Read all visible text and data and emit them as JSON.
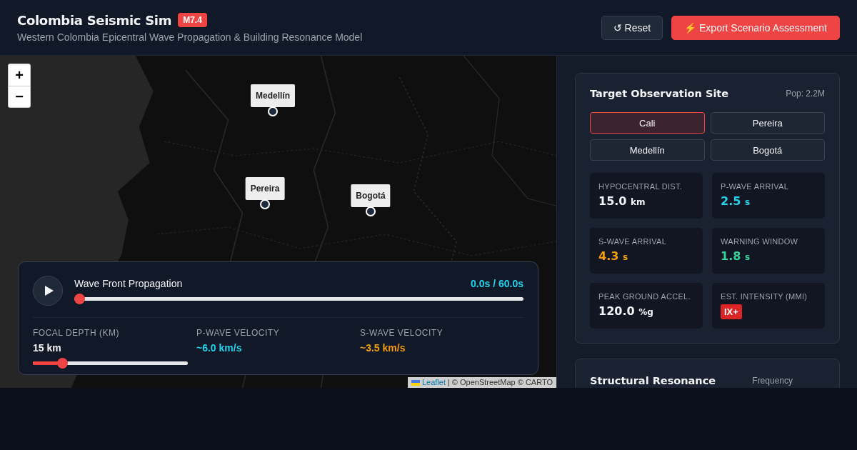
{
  "header": {
    "title": "Colombia Seismic Sim",
    "magnitude": "M7.4",
    "subtitle": "Western Colombia Epicentral Wave Propagation & Building Resonance Model",
    "reset": {
      "icon": "↺",
      "label": "Reset"
    },
    "export": {
      "icon": "⚡",
      "label": "Export Scenario Assessment"
    }
  },
  "map": {
    "zoom": [
      "+",
      "−"
    ],
    "markers": [
      {
        "label": "Medellín"
      },
      {
        "label": "Pereira"
      },
      {
        "label": "Bogotá"
      }
    ],
    "attribution": {
      "link": "Leaflet",
      "text": "| © OpenStreetMap © CARTO"
    }
  },
  "playback": {
    "title": "Wave Front Propagation",
    "time": "0.0s / 60.0s",
    "level": 0,
    "params": [
      {
        "kind": "slider",
        "label": "FOCAL DEPTH (KM)",
        "value": "15 km",
        "level": 0.17
      },
      {
        "kind": "reading",
        "label": "P-WAVE VELOCITY",
        "value": "~6.0 km/s",
        "color": "#22d3ee"
      },
      {
        "kind": "reading",
        "label": "S-WAVE VELOCITY",
        "value": "~3.5 km/s",
        "color": "#f59e0b"
      }
    ]
  },
  "site": {
    "title": "Target Observation Site",
    "population": "Pop: 2.2M",
    "options": [
      {
        "label": "Cali",
        "selected": true
      },
      {
        "label": "Pereira",
        "selected": false
      },
      {
        "label": "Medellín",
        "selected": false
      },
      {
        "label": "Bogotá",
        "selected": false
      }
    ],
    "metrics": [
      {
        "kind": "value",
        "label": "HYPOCENTRAL DIST.",
        "value": "15.0",
        "unit": "km",
        "color": "#f3f4f6"
      },
      {
        "kind": "value",
        "label": "P-WAVE ARRIVAL",
        "value": "2.5",
        "unit": "s",
        "color": "#22d3ee"
      },
      {
        "kind": "value",
        "label": "S-WAVE ARRIVAL",
        "value": "4.3",
        "unit": "s",
        "color": "#f59e0b"
      },
      {
        "kind": "value",
        "label": "WARNING WINDOW",
        "value": "1.8",
        "unit": "s",
        "color": "#34d399"
      },
      {
        "kind": "value",
        "label": "PEAK GROUND ACCEL.",
        "value": "120.0",
        "unit": "%g",
        "color": "#f3f4f6"
      },
      {
        "kind": "badge",
        "label": "EST. INTENSITY (MMI)",
        "value": "IX+",
        "color": "#dc2626"
      }
    ]
  },
  "resonance": {
    "title": "Structural Resonance",
    "column": "Frequency"
  }
}
